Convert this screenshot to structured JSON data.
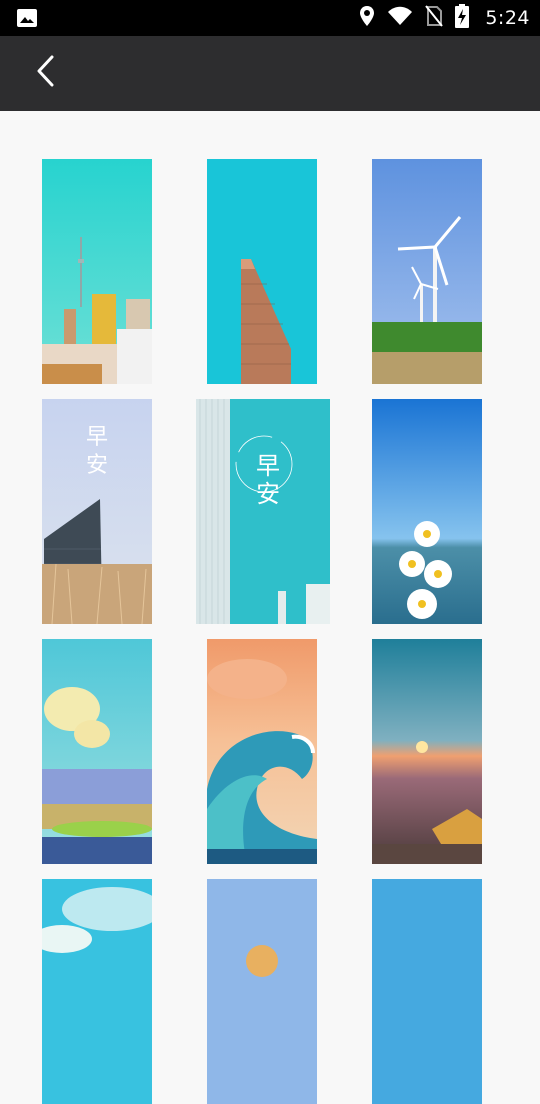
{
  "status_bar": {
    "time": "5:24",
    "icons": [
      "image-icon",
      "location-icon",
      "wifi-icon",
      "no-sim-icon",
      "battery-charging-icon"
    ]
  },
  "app_bar": {
    "back_icon": "chevron-left-icon"
  },
  "wallpapers": [
    {
      "id": "city-tower",
      "bg": "#2fd0cf"
    },
    {
      "id": "flatiron-building",
      "bg": "#1fc4d6"
    },
    {
      "id": "wind-turbines",
      "bg": "#6f9ee0"
    },
    {
      "id": "good-morning-pampas",
      "bg": "#c9d6ee",
      "text": "早安"
    },
    {
      "id": "good-morning-building",
      "bg": "#2fbfca",
      "text": "早安"
    },
    {
      "id": "daisies-lake",
      "bg": "#1e7ed8"
    },
    {
      "id": "painted-landscape",
      "bg": "#57c8d8"
    },
    {
      "id": "great-wave",
      "bg": "#f2a070"
    },
    {
      "id": "sunset-bottle",
      "bg": "#3a8aa8"
    },
    {
      "id": "painted-sky-partial",
      "bg": "#38c2e0"
    },
    {
      "id": "blue-orange-partial",
      "bg": "#8fb7e8"
    },
    {
      "id": "blue-sky-partial",
      "bg": "#45a9e0"
    }
  ]
}
